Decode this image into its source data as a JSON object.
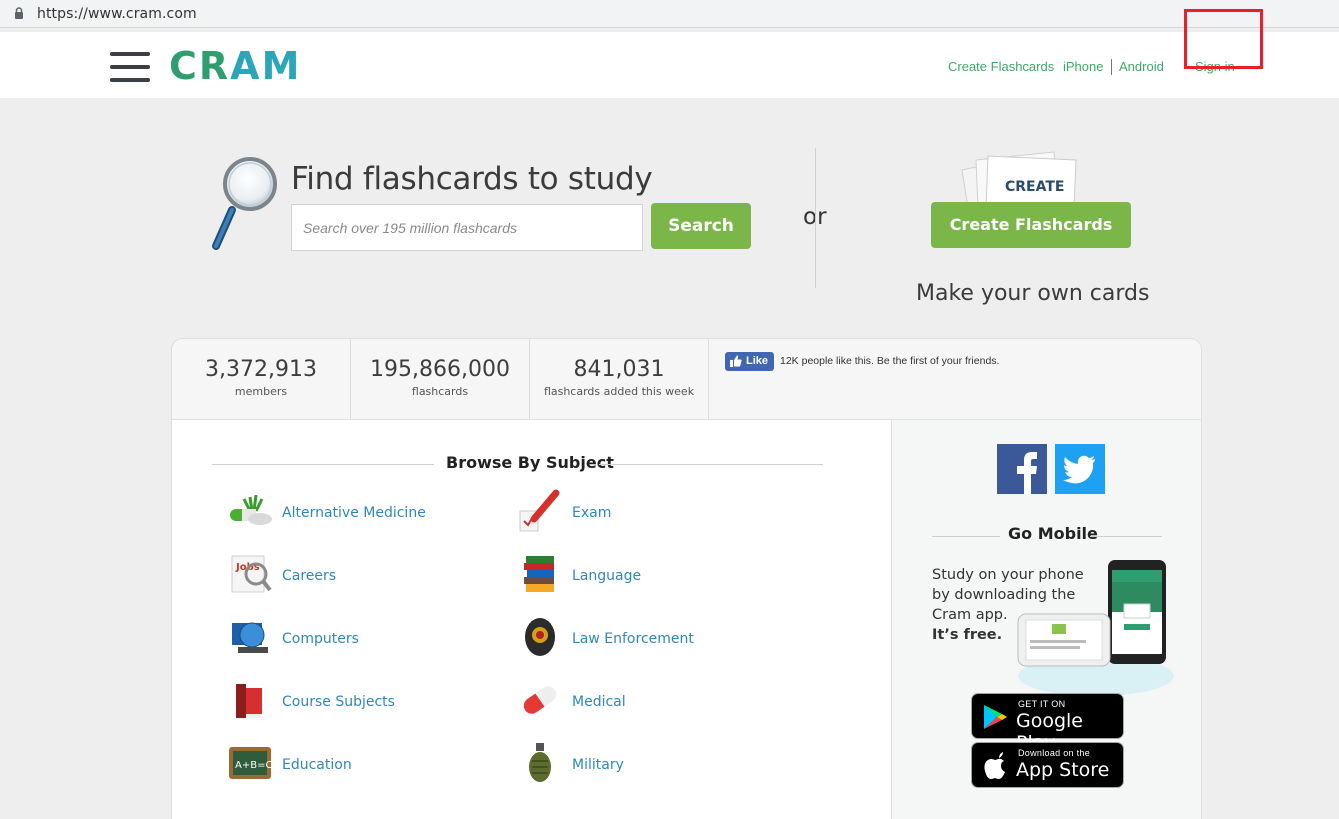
{
  "browser": {
    "url": "https://www.cram.com"
  },
  "header": {
    "logo_cr": "CR",
    "logo_am": "AM",
    "links": {
      "create": "Create Flashcards",
      "iphone": "iPhone",
      "android": "Android",
      "signin": "Sign in"
    }
  },
  "hero": {
    "title": "Find flashcards to study",
    "search_placeholder": "Search over 195 million flashcards",
    "search_button": "Search",
    "or": "or",
    "create_card_text": "CREATE",
    "create_button": "Create Flashcards",
    "make_own": "Make your own cards"
  },
  "stats": [
    {
      "value": "3,372,913",
      "label": "members"
    },
    {
      "value": "195,866,000",
      "label": "flashcards"
    },
    {
      "value": "841,031",
      "label": "flashcards added this week"
    }
  ],
  "facebook": {
    "like_label": "Like",
    "text": "12K people like this. Be the first of your friends."
  },
  "browse": {
    "title": "Browse By Subject",
    "subjects_left": [
      "Alternative Medicine",
      "Careers",
      "Computers",
      "Course Subjects",
      "Education"
    ],
    "subjects_right": [
      "Exam",
      "Language",
      "Law Enforcement",
      "Medical",
      "Military"
    ]
  },
  "mobile": {
    "title": "Go Mobile",
    "text": "Study on your phone by downloading the Cram app.",
    "free": "It’s free.",
    "google_small": "GET IT ON",
    "google_big": "Google Play",
    "apple_small": "Download on the",
    "apple_big": "App Store"
  },
  "colors": {
    "brand_green": "#2e9e71",
    "brand_teal": "#2aa6b8",
    "button_green": "#7ab648",
    "link_blue": "#2f87b9",
    "highlight_red": "#e8202a"
  }
}
